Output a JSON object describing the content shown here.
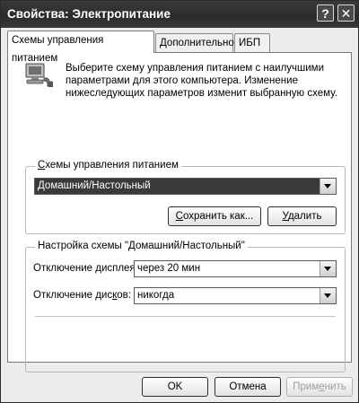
{
  "window": {
    "title": "Свойства: Электропитание",
    "help_label": "?",
    "close_label": "✕"
  },
  "tabs": [
    {
      "label": "Схемы управления питанием",
      "active": true
    },
    {
      "label": "Дополнительно",
      "active": false
    },
    {
      "label": "ИБП",
      "active": false
    }
  ],
  "intro": {
    "icon": "power-computer-icon",
    "line1": "Выберите схему управления питанием с наилучшими",
    "line2": "параметрами для этого компьютера. Изменение",
    "line3": "нижеследующих параметров изменит выбранную схему."
  },
  "schemes": {
    "legend_first": "С",
    "legend_rest": "хемы управления питанием",
    "selected": "Домашний/Настольный",
    "save_as_first": "С",
    "save_as_rest": "охранить как...",
    "delete_first": "У",
    "delete_rest": "далить"
  },
  "config": {
    "legend": "Настройка схемы \"Домашний/Настольный\"",
    "monitor_label_pre": "Отключение ",
    "monitor_label_u": "д",
    "monitor_label_post": "исплея:",
    "monitor_value": "через 20 мин",
    "disks_label_pre": "Отключение дис",
    "disks_label_u": "к",
    "disks_label_post": "ов:",
    "disks_value": "никогда"
  },
  "footer": {
    "ok": "OK",
    "cancel": "Отмена",
    "apply_pre": "Прим",
    "apply_u": "е",
    "apply_post": "нить"
  }
}
